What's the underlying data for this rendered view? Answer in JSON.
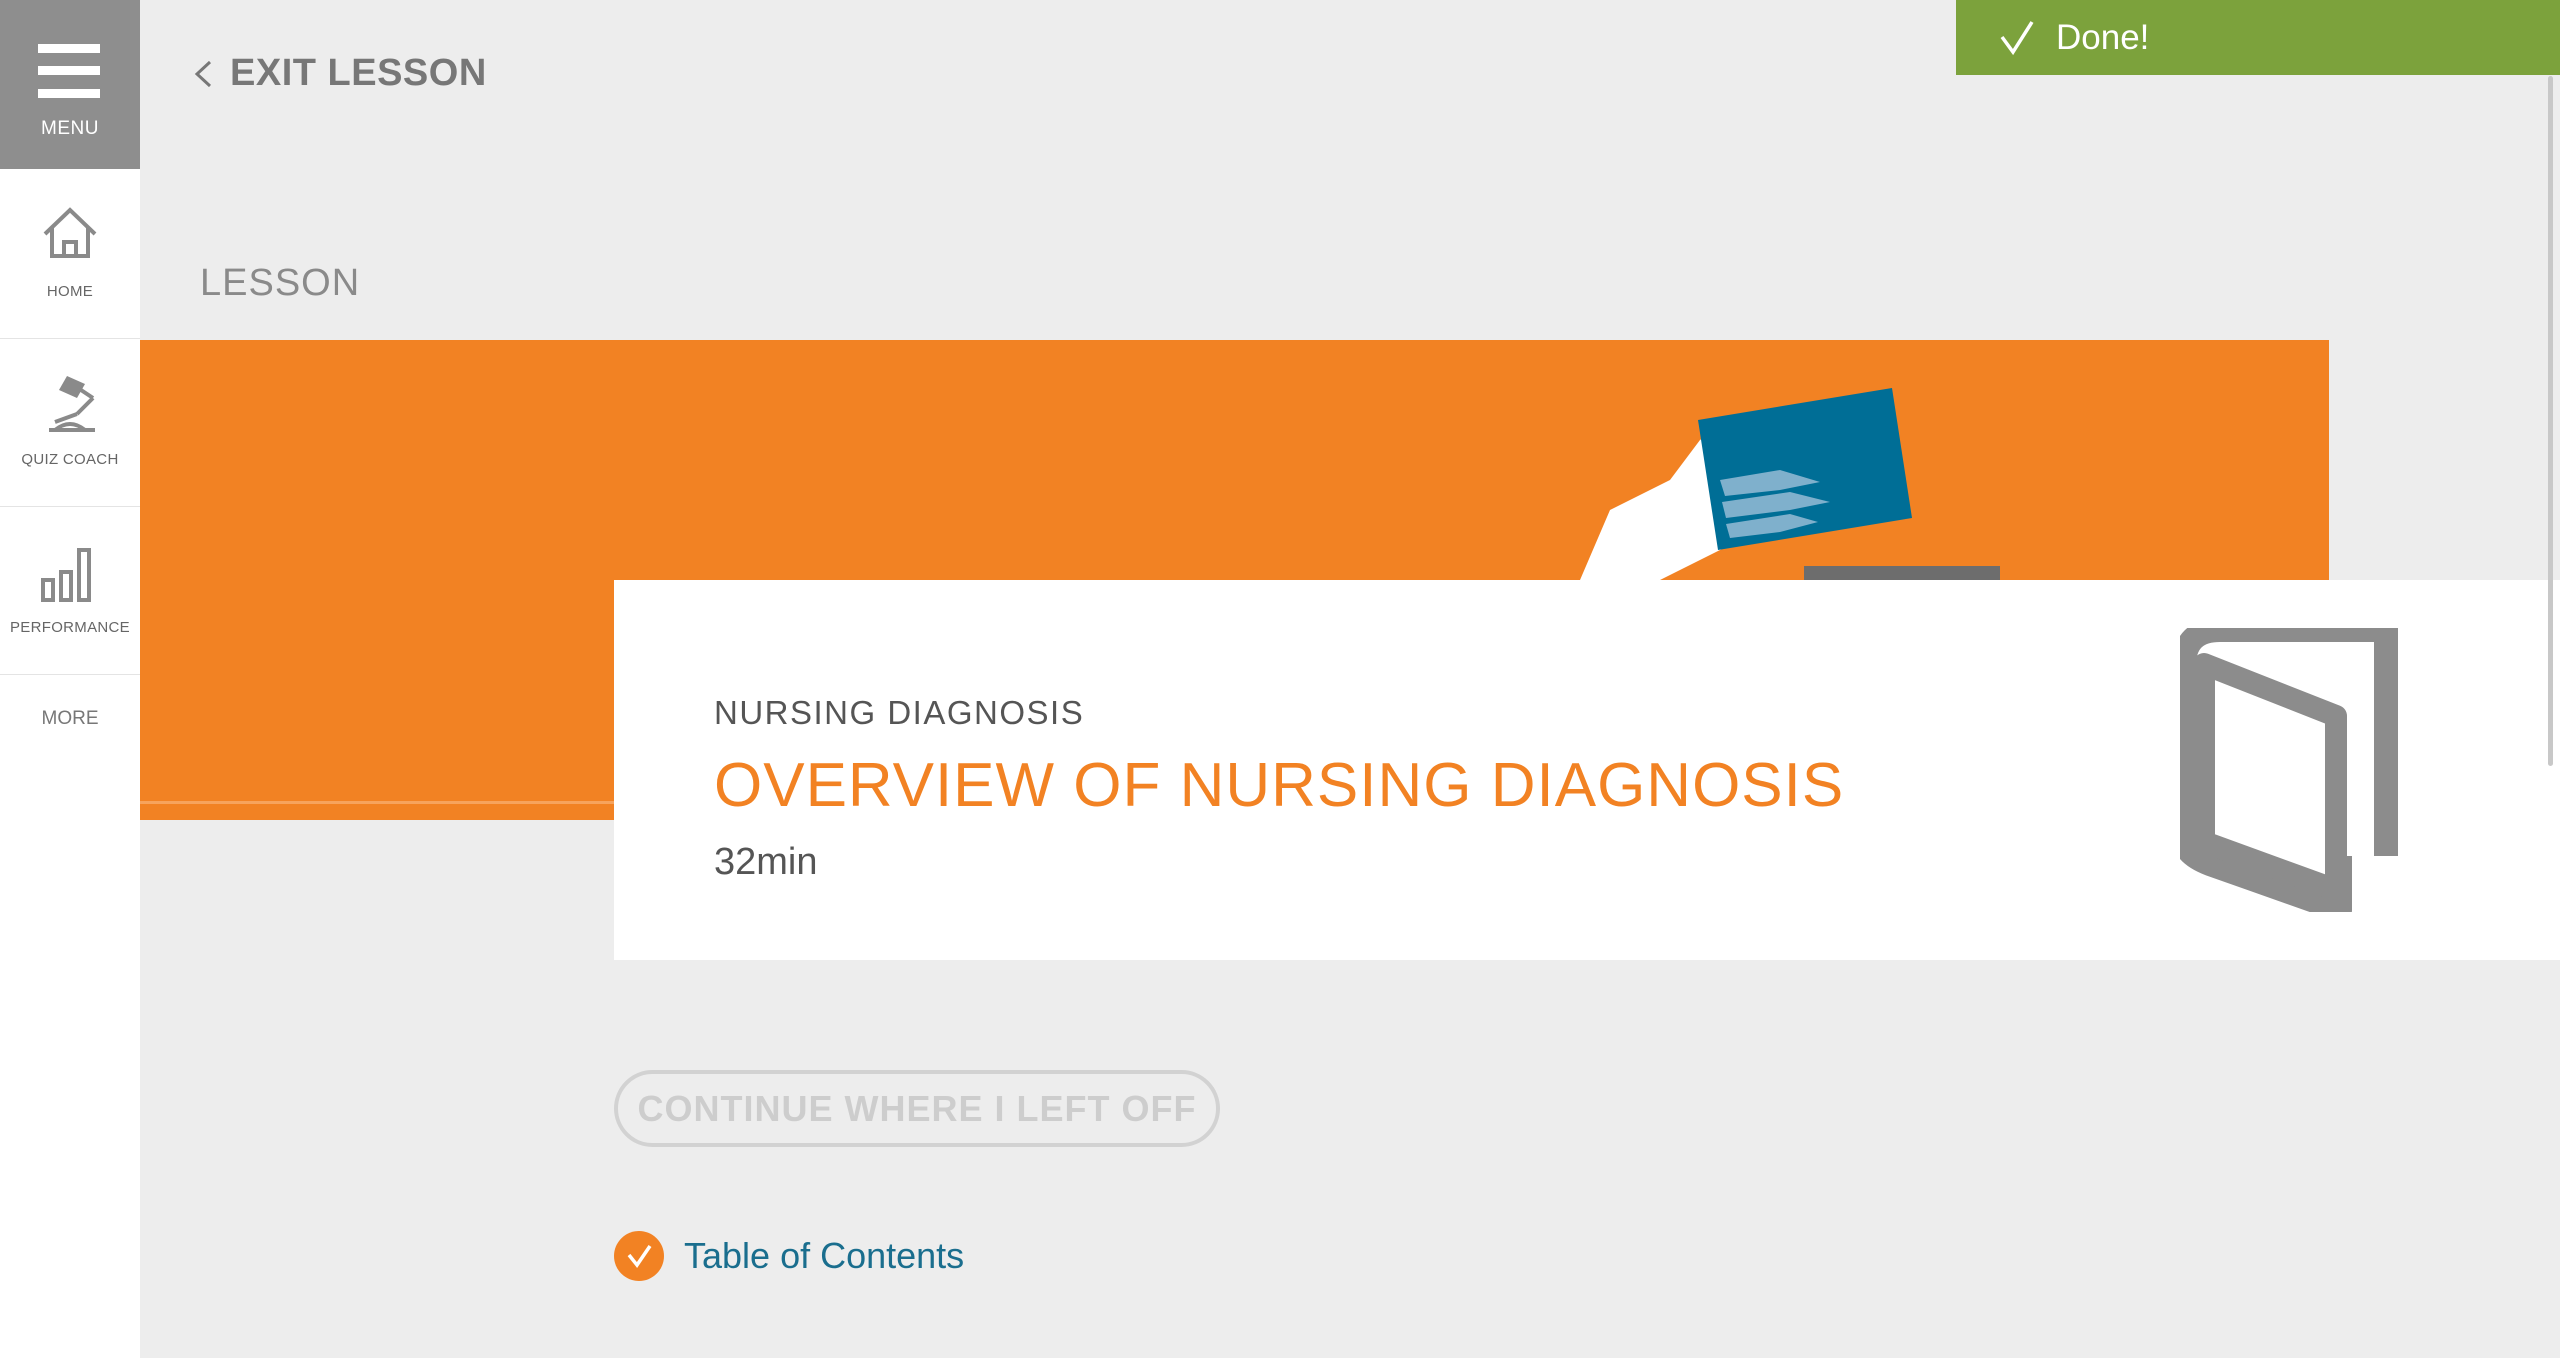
{
  "sidebar": {
    "menu_label": "MENU",
    "items": [
      {
        "label": "HOME",
        "icon": "home-icon"
      },
      {
        "label": "QUIZ COACH",
        "icon": "lamp-icon"
      },
      {
        "label": "PERFORMANCE",
        "icon": "bar-chart-icon"
      }
    ],
    "more_label": "MORE"
  },
  "header": {
    "exit_label": "EXIT LESSON",
    "done_label": "Done!",
    "section_label": "LESSON"
  },
  "lesson": {
    "category": "NURSING DIAGNOSIS",
    "title": "OVERVIEW OF NURSING DIAGNOSIS",
    "duration": "32min"
  },
  "actions": {
    "continue_label": "CONTINUE WHERE I LEFT OFF",
    "toc_label": "Table of Contents"
  },
  "colors": {
    "accent_orange": "#f28223",
    "done_green": "#7ca23c",
    "link_blue": "#1a6e8e",
    "card_blue": "#006e96"
  }
}
